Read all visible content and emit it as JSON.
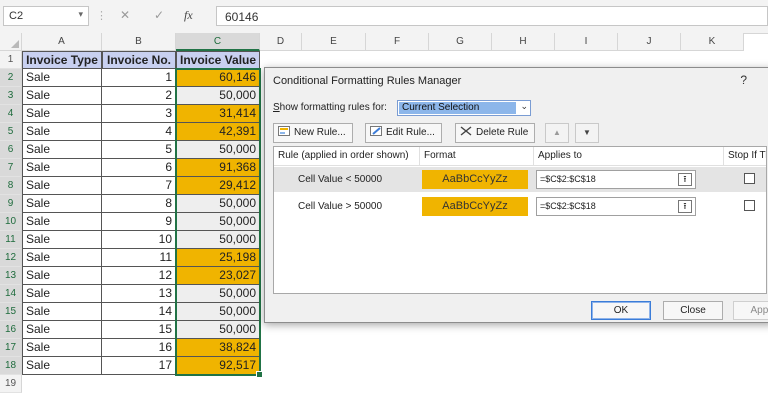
{
  "formula_bar": {
    "name_box": "C2",
    "name_box_dropdown": "▾",
    "separator": "⋮",
    "cancel_icon": "✕",
    "enter_icon": "✓",
    "function_icon": "fx",
    "formula": "60146"
  },
  "sheet": {
    "columns": [
      "A",
      "B",
      "C",
      "D",
      "E",
      "F",
      "G",
      "H",
      "I",
      "J",
      "K"
    ],
    "row_numbers": [
      "1",
      "2",
      "3",
      "4",
      "5",
      "6",
      "7",
      "8",
      "9",
      "10",
      "11",
      "12",
      "13",
      "14",
      "15",
      "16",
      "17",
      "18",
      "19"
    ],
    "headers": [
      "Invoice Type",
      "Invoice No.",
      "Invoice Value"
    ],
    "rows": [
      {
        "type": "Sale",
        "no": "1",
        "value": "60,146"
      },
      {
        "type": "Sale",
        "no": "2",
        "value": "50,000"
      },
      {
        "type": "Sale",
        "no": "3",
        "value": "31,414"
      },
      {
        "type": "Sale",
        "no": "4",
        "value": "42,391"
      },
      {
        "type": "Sale",
        "no": "5",
        "value": "50,000"
      },
      {
        "type": "Sale",
        "no": "6",
        "value": "91,368"
      },
      {
        "type": "Sale",
        "no": "7",
        "value": "29,412"
      },
      {
        "type": "Sale",
        "no": "8",
        "value": "50,000"
      },
      {
        "type": "Sale",
        "no": "9",
        "value": "50,000"
      },
      {
        "type": "Sale",
        "no": "10",
        "value": "50,000"
      },
      {
        "type": "Sale",
        "no": "11",
        "value": "25,198"
      },
      {
        "type": "Sale",
        "no": "12",
        "value": "23,027"
      },
      {
        "type": "Sale",
        "no": "13",
        "value": "50,000"
      },
      {
        "type": "Sale",
        "no": "14",
        "value": "50,000"
      },
      {
        "type": "Sale",
        "no": "15",
        "value": "50,000"
      },
      {
        "type": "Sale",
        "no": "16",
        "value": "38,824"
      },
      {
        "type": "Sale",
        "no": "17",
        "value": "92,517"
      }
    ],
    "highlight_color": "#f0b400",
    "header_fill": "#c8d0f0"
  },
  "dialog": {
    "title": "Conditional Formatting Rules Manager",
    "help": "?",
    "show_label": "Show formatting rules for:",
    "show_value": "Current Selection",
    "dropdown_arrow": "⌄",
    "buttons": {
      "new_rule": "New Rule...",
      "edit_rule": "Edit Rule...",
      "delete_rule": "Delete Rule",
      "move_up": "▲",
      "move_down": "▼"
    },
    "columns": {
      "rule": "Rule (applied in order shown)",
      "format": "Format",
      "applies_to": "Applies to",
      "stop_if_true": "Stop If True"
    },
    "rules": [
      {
        "name": "Cell Value < 50000",
        "sample": "AaBbCcYyZz",
        "applies_to": "=$C$2:$C$18",
        "collapse_icon": "⭱"
      },
      {
        "name": "Cell Value > 50000",
        "sample": "AaBbCcYyZz",
        "applies_to": "=$C$2:$C$18",
        "collapse_icon": "⭱"
      }
    ],
    "footer": {
      "ok": "OK",
      "close": "Close",
      "apply": "Apply"
    }
  }
}
